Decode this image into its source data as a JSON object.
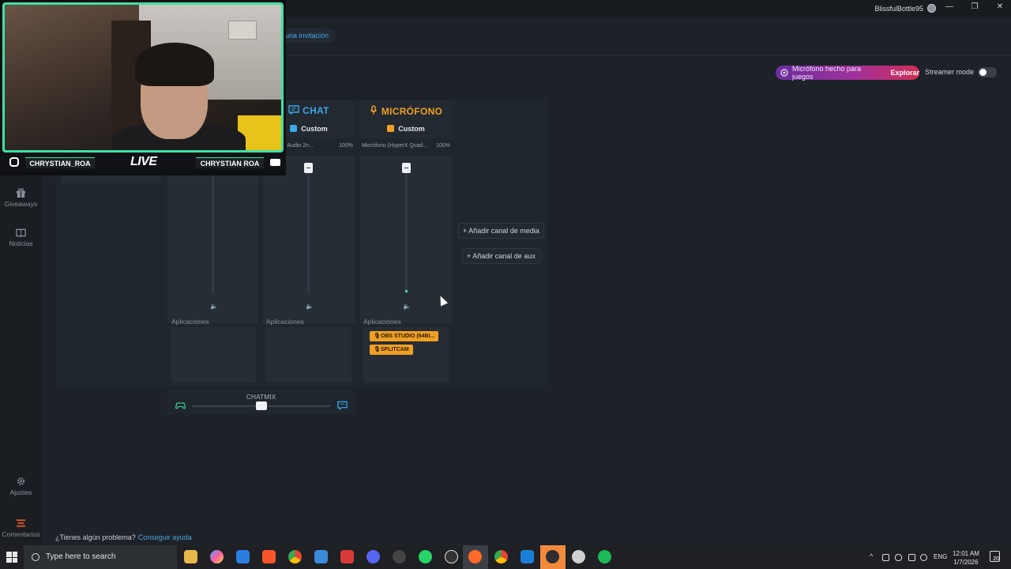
{
  "titlebar": {
    "username": "BlissfulBottle95",
    "minimize": "—",
    "restore": "❐",
    "close": "✕"
  },
  "sidebar": {
    "items": [
      {
        "label": "Giveaways",
        "icon": "gift-icon"
      },
      {
        "label": "Noticias",
        "icon": "book-icon"
      },
      {
        "label": "Ajustes",
        "icon": "gear-icon"
      },
      {
        "label": "Comentarios",
        "icon": "feedback-icon"
      }
    ]
  },
  "header": {
    "invite_label": "una invitación",
    "promo_text": "Micrófono hecho para juegos",
    "promo_action": "Explorar",
    "streamer_mode_label": "Streamer mode",
    "streamer_mode_on": false
  },
  "mixer": {
    "channels": [
      {
        "id": "game",
        "title": "",
        "preset": "",
        "device": "",
        "level": "",
        "volume_fraction": 1.0,
        "apps_label": "Aplicaciones",
        "apps": []
      },
      {
        "id": "chat",
        "title": "CHAT",
        "preset": "Custom",
        "device": "altek HD Audio 2n...",
        "level": "100%",
        "volume_fraction": 1.0,
        "apps_label": "Aplicaciones",
        "apps": []
      },
      {
        "id": "mic",
        "title": "MICRÓFONO",
        "preset": "Custom",
        "device": "Micrófono (HyperX Quad...",
        "level": "100%",
        "volume_fraction": 1.0,
        "apps_label": "Aplicaciones",
        "apps": [
          "OBS STUDIO (64BI...",
          "SPLITCAM"
        ]
      }
    ],
    "add_media": "+ Añadir canal de media",
    "add_aux": "+ Añadir canal de aux",
    "chatmix_label": "CHATMIX",
    "chatmix_position": 0.5
  },
  "help": {
    "question": "¿Tienes algún problema?",
    "link": "Conseguir ayuda"
  },
  "webcam": {
    "left_name": "CHRYSTIAN_ROA",
    "live": "LIVE",
    "right_name": "CHRYSTIAN ROA"
  },
  "taskbar": {
    "search_placeholder": "Type here to search",
    "language": "ENG",
    "time": "12:01 AM",
    "date": "1/7/2026",
    "notifications": "20"
  },
  "colors": {
    "chat": "#3aa8e8",
    "mic": "#f0a024",
    "accent_green": "#3fe0a6",
    "link": "#4ea3e0"
  }
}
